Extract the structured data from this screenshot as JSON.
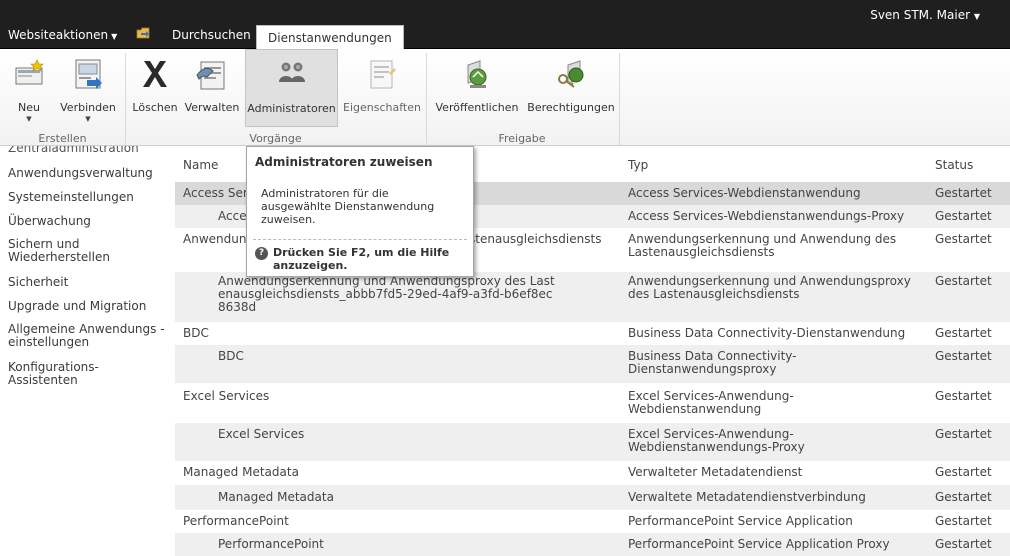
{
  "topbar": {
    "site_actions": "Websiteaktionen",
    "tabs": [
      "Durchsuchen",
      "Dienstanwendungen"
    ],
    "user": "Sven STM. Maier"
  },
  "ribbon": {
    "buttons": [
      "Neu",
      "Verbinden",
      "Löschen",
      "Verwalten",
      "Administratoren",
      "Eigenschaften",
      "Veröffentlichen",
      "Berechtigungen"
    ],
    "groups": [
      "Erstellen",
      "Vorgänge",
      "Freigabe"
    ]
  },
  "nav": {
    "items": [
      "Zentraladministration",
      "Anwendungsverwaltung",
      "Systemeinstellungen",
      "Überwachung",
      "Sichern und Wiederherstellen",
      "Sicherheit",
      "Upgrade und Migration",
      "Allgemeine Anwendungs - einstellungen",
      "Konfigurations-Assistenten"
    ]
  },
  "list": {
    "headers": [
      "Name",
      "Typ",
      "Status"
    ],
    "rows": [
      {
        "name": "Access Services",
        "type": "Access Services-Webdienstanwendung",
        "status": "Gestartet"
      },
      {
        "name": "Access Services",
        "type": "Access Services-Webdienstanwendungs-Proxy",
        "status": "Gestartet"
      },
      {
        "name": "Anwendungserkennung und Anwendung des Lastenausgleichsdiensts",
        "type": "Anwendungserkennung und Anwendung des Lastenausgleichsdiensts",
        "status": "Gestartet"
      },
      {
        "name": "Anwendungserkennung und Anwendungsproxy des Lastenausgleichsdiensts_abbb7fd5-29ed-4af9-a3fd-b6ef8ec8638d",
        "type": "Anwendungserkennung und Anwendungsproxy des Lastenausgleichsdiensts",
        "status": "Gestartet"
      },
      {
        "name": "BDC",
        "type": "Business Data Connectivity-Dienstanwendung",
        "status": "Gestartet"
      },
      {
        "name": "BDC",
        "type": "Business Data Connectivity-Dienstanwendungsproxy",
        "status": "Gestartet"
      },
      {
        "name": "Excel Services",
        "type": "Excel Services-Anwendung-Webdienstanwendung",
        "status": "Gestartet"
      },
      {
        "name": "Excel Services",
        "type": "Excel Services-Anwendung-Webdienstanwendungs-Proxy",
        "status": "Gestartet"
      },
      {
        "name": "Managed Metadata",
        "type": "Verwalteter Metadatendienst",
        "status": "Gestartet"
      },
      {
        "name": "Managed Metadata",
        "type": "Verwaltete Metadatendienstverbindung",
        "status": "Gestartet"
      },
      {
        "name": "PerformancePoint",
        "type": "PerformancePoint Service Application",
        "status": "Gestartet"
      },
      {
        "name": "PerformancePoint",
        "type": "PerformancePoint Service Application Proxy",
        "status": "Gestartet"
      }
    ]
  },
  "tooltip": {
    "title": "Administratoren zuweisen",
    "body": "Administratoren für die ausgewählte Dienstanwendung zuweisen.",
    "help": "Drücken Sie F2, um die Hilfe anzuzeigen."
  }
}
